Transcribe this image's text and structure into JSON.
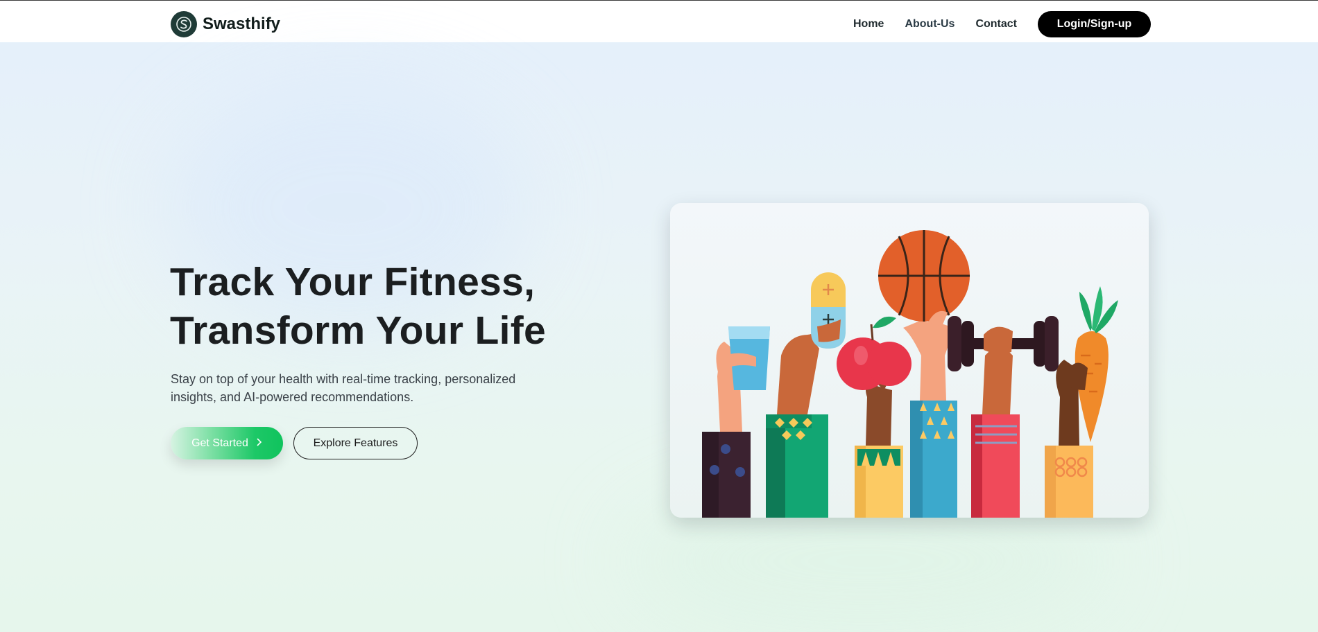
{
  "brand": {
    "name": "Swasthify",
    "logo_icon": "s-logo-icon",
    "logo_color": "#1f3b37"
  },
  "nav": {
    "items": [
      {
        "label": "Home"
      },
      {
        "label": "About-Us"
      },
      {
        "label": "Contact"
      }
    ],
    "login_label": "Login/Sign-up"
  },
  "hero": {
    "title_line1": "Track Your Fitness,",
    "title_line2": "Transform Your Life",
    "subtitle": "Stay on top of your health with real-time tracking, personalized insights, and AI-powered recommendations.",
    "primary_button": "Get Started",
    "primary_button_icon": "chevron-right-icon",
    "secondary_button": "Explore Features"
  },
  "illustration": {
    "objects": [
      "water-glass-icon",
      "pill-capsule-icon",
      "apple-icon",
      "basketball-icon",
      "dumbbell-icon",
      "carrot-icon"
    ]
  },
  "colors": {
    "accent_green": "#10c35d",
    "login_bg": "#000000",
    "text_dark": "#1b1e20"
  }
}
